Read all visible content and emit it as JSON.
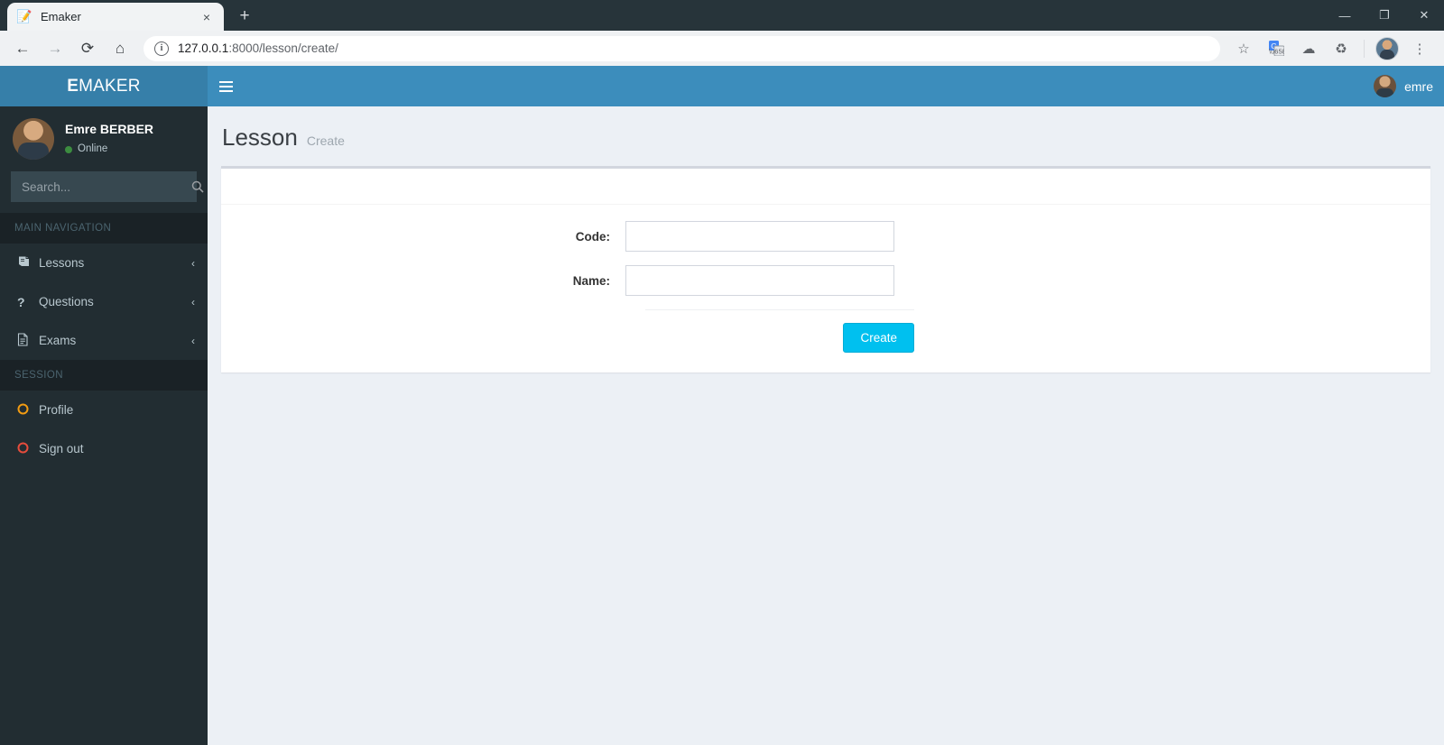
{
  "browser": {
    "tab": {
      "title": "Emaker",
      "favicon": "notepad-icon",
      "close": "×"
    },
    "new_tab_label": "+",
    "window_controls": {
      "minimize": "—",
      "maximize": "❐",
      "close": "✕"
    },
    "toolbar": {
      "back": "←",
      "forward": "→",
      "reload": "⟳",
      "home": "⌂",
      "bookmark": "☆",
      "translate": "G",
      "cloud": "☁",
      "recycle": "♻",
      "menu": "⋮"
    },
    "omnibox": {
      "info": "i",
      "host": "127.0.0.1",
      "path": ":8000/lesson/create/",
      "url": "127.0.0.1:8000/lesson/create/"
    }
  },
  "app": {
    "logo": {
      "first": "E",
      "rest": "MAKER"
    },
    "navbar": {
      "toggle": "menu-toggle",
      "username": "emre"
    },
    "sidebar": {
      "user": {
        "name": "Emre BERBER",
        "status": "Online"
      },
      "search": {
        "placeholder": "Search...",
        "value": "",
        "button_icon": "search-icon"
      },
      "sections": [
        {
          "header": "MAIN NAVIGATION",
          "items": [
            {
              "label": "Lessons",
              "icon": "📕",
              "icon_name": "book-icon",
              "chevron": "‹",
              "color": ""
            },
            {
              "label": "Questions",
              "icon": "?",
              "icon_name": "question-icon",
              "chevron": "‹",
              "color": ""
            },
            {
              "label": "Exams",
              "icon": "🗎",
              "icon_name": "document-icon",
              "chevron": "‹",
              "color": ""
            }
          ]
        },
        {
          "header": "SESSION",
          "items": [
            {
              "label": "Profile",
              "icon": "○",
              "icon_name": "circle-icon-orange",
              "chevron": "",
              "color": "orange"
            },
            {
              "label": "Sign out",
              "icon": "○",
              "icon_name": "circle-icon-red",
              "chevron": "",
              "color": "red"
            }
          ]
        }
      ]
    },
    "page": {
      "title": "Lesson",
      "subtitle": "Create",
      "form": {
        "fields": [
          {
            "label": "Code:",
            "value": "",
            "placeholder": "",
            "name": "code"
          },
          {
            "label": "Name:",
            "value": "",
            "placeholder": "",
            "name": "name"
          }
        ],
        "submit_label": "Create"
      }
    }
  },
  "colors": {
    "navbar": "#3c8dbc",
    "logo_bg": "#367fa9",
    "sidebar": "#222d32",
    "sidebar_header": "#1a2226",
    "content_bg": "#ecf0f5",
    "button": "#00c0ef",
    "online": "#3c8c40",
    "profile_icon": "#f39c12",
    "signout_icon": "#e74c3c"
  }
}
